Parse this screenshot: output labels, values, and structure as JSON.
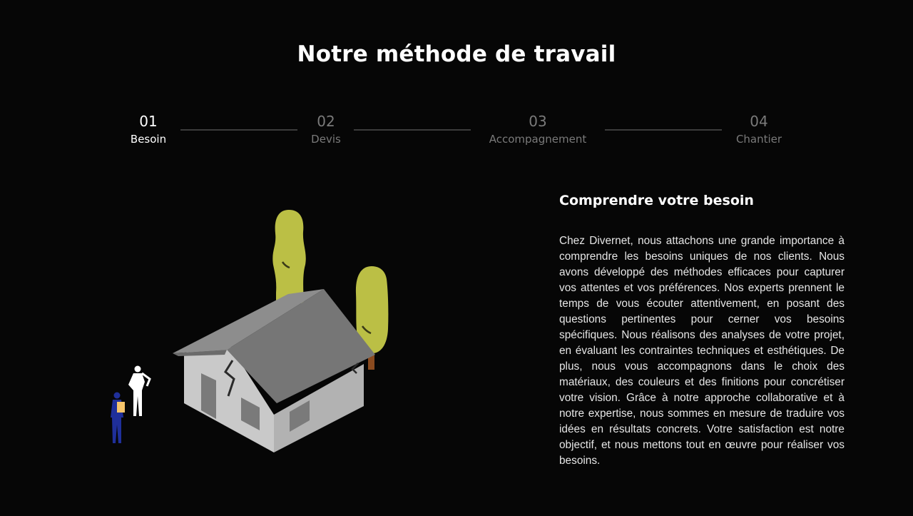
{
  "header": {
    "title": "Notre méthode de travail"
  },
  "steps": [
    {
      "num": "01",
      "label": "Besoin",
      "active": true
    },
    {
      "num": "02",
      "label": "Devis",
      "active": false
    },
    {
      "num": "03",
      "label": "Accompagnement",
      "active": false
    },
    {
      "num": "04",
      "label": "Chantier",
      "active": false
    }
  ],
  "content": {
    "title": "Comprendre votre besoin",
    "body": "Chez Divernet, nous attachons une grande importance à comprendre les besoins uniques de nos clients. Nous avons développé des méthodes efficaces pour capturer vos attentes et vos préférences. Nos experts prennent le temps de vous écouter attentivement, en posant des questions pertinentes pour cerner vos besoins spécifiques. Nous réalisons des analyses de votre projet, en évaluant les contraintes techniques et esthétiques. De plus, nous vous accompagnons dans le choix des matériaux, des couleurs et des finitions pour concrétiser votre vision. Grâce à notre approche collaborative et à notre expertise, nous sommes en mesure de traduire vos idées en résultats concrets. Votre satisfaction est notre objectif, et nous mettons tout en œuvre pour réaliser vos besoins."
  },
  "colors": {
    "background": "#060606",
    "active_text": "#ffffff",
    "inactive_text": "#7a7a7a",
    "connector": "#3c3c3c",
    "tree": "#bbbf45",
    "roof": "#767676",
    "wall": "#c9c9c9",
    "person_blue": "#1f2f9a",
    "folder": "#f5c46b"
  },
  "illustration": {
    "icon": "house-crack-illustration"
  }
}
